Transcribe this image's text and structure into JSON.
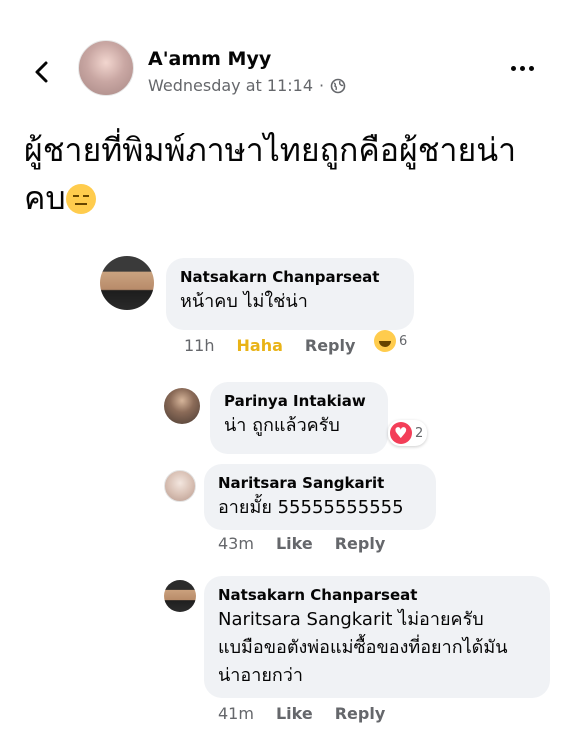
{
  "post": {
    "author": "A'amm Myy",
    "timestamp": "Wednesday at 11:14",
    "separator": "·",
    "text": "ผู้ชายที่พิมพ์ภาษาไทยถูกคือผู้ชายน่าคบ"
  },
  "comments": [
    {
      "name": "Natsakarn Chanparseat",
      "text": "หน้าคบ ไม่ใช่น่า",
      "time": "11h",
      "like_label": "Haha",
      "reply_label": "Reply",
      "reaction_count": "6"
    },
    {
      "name": "Parinya Intakiaw",
      "text": "น่า ถูกแล้วครับ",
      "reaction_count": "2"
    },
    {
      "name": "Naritsara Sangkarit",
      "text": "อายมั้ย 55555555555",
      "time": "43m",
      "like_label": "Like",
      "reply_label": "Reply"
    },
    {
      "name": "Natsakarn Chanparseat",
      "mention": "Naritsara Sangkarit",
      "text_line1": "ไม่อายครับ",
      "text_line2": "แบมือขอตังพ่อแม่ซื้อของที่อยากได้มัน",
      "text_line3": "น่าอายกว่า",
      "time": "41m",
      "like_label": "Like",
      "reply_label": "Reply"
    }
  ],
  "icons": {
    "back": "chevron-left-icon",
    "privacy": "globe-icon",
    "more": "more-horizontal-icon",
    "post_emoji": "expressionless-face-emoji",
    "haha_reaction": "haha-reaction-icon",
    "love_reaction": "love-reaction-icon"
  },
  "colors": {
    "bubble": "#f0f2f5",
    "secondary_text": "#65676b",
    "haha": "#e9b317",
    "love": "#f33e58"
  }
}
